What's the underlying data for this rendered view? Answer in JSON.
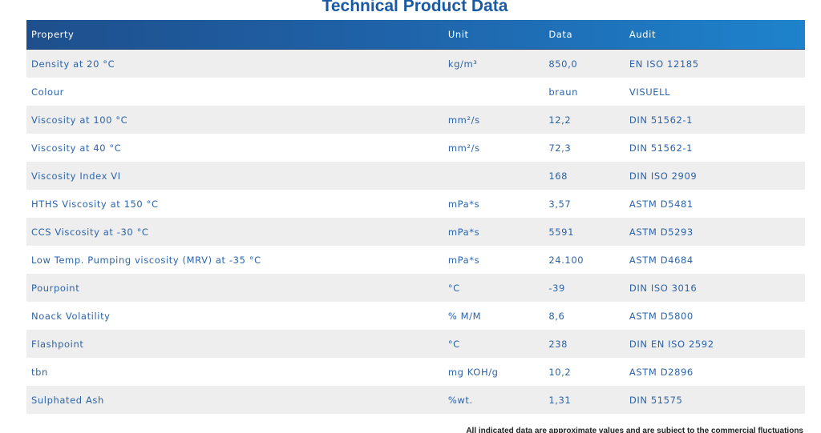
{
  "title": "Technical Product Data",
  "table": {
    "headers": {
      "property": "Property",
      "unit": "Unit",
      "data": "Data",
      "audit": "Audit"
    },
    "rows": [
      {
        "property": "Density at 20 °C",
        "unit": "kg/m³",
        "data": "850,0",
        "audit": "EN ISO 12185"
      },
      {
        "property": "Colour",
        "unit": "",
        "data": "braun",
        "audit": "VISUELL"
      },
      {
        "property": "Viscosity at 100 °C",
        "unit": "mm²/s",
        "data": "12,2",
        "audit": "DIN 51562-1"
      },
      {
        "property": "Viscosity at 40 °C",
        "unit": "mm²/s",
        "data": "72,3",
        "audit": "DIN 51562-1"
      },
      {
        "property": "Viscosity Index VI",
        "unit": "",
        "data": "168",
        "audit": "DIN ISO 2909"
      },
      {
        "property": "HTHS Viscosity at 150 °C",
        "unit": "mPa*s",
        "data": "3,57",
        "audit": "ASTM D5481"
      },
      {
        "property": "CCS Viscosity at -30 °C",
        "unit": "mPa*s",
        "data": "5591",
        "audit": "ASTM D5293"
      },
      {
        "property": "Low Temp. Pumping viscosity (MRV) at -35 °C",
        "unit": "mPa*s",
        "data": "24.100",
        "audit": "ASTM D4684"
      },
      {
        "property": "Pourpoint",
        "unit": "°C",
        "data": "-39",
        "audit": "DIN ISO 3016"
      },
      {
        "property": "Noack Volatility",
        "unit": "% M/M",
        "data": "8,6",
        "audit": "ASTM D5800"
      },
      {
        "property": "Flashpoint",
        "unit": "°C",
        "data": "238",
        "audit": "DIN EN ISO 2592"
      },
      {
        "property": "tbn",
        "unit": "mg KOH/g",
        "data": "10,2",
        "audit": "ASTM D2896"
      },
      {
        "property": "Sulphated Ash",
        "unit": "%wt.",
        "data": "1,31",
        "audit": "DIN 51575"
      }
    ]
  },
  "footnote": "All indicated data are approximate values and are subject to the commercial fluctuations"
}
